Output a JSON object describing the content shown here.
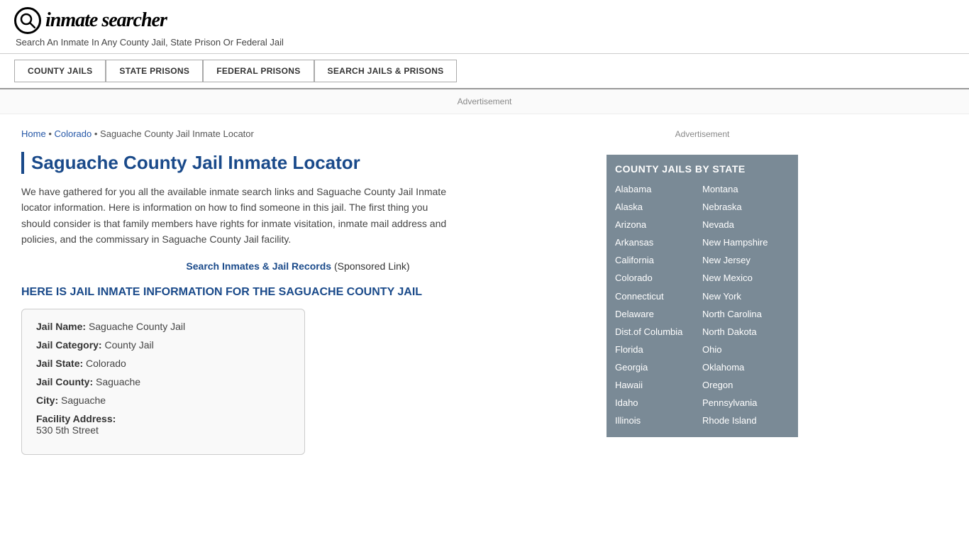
{
  "header": {
    "logo_icon": "🔍",
    "logo_text": "inmate searcher",
    "tagline": "Search An Inmate In Any County Jail, State Prison Or Federal Jail"
  },
  "nav": {
    "buttons": [
      {
        "label": "COUNTY JAILS",
        "id": "county-jails"
      },
      {
        "label": "STATE PRISONS",
        "id": "state-prisons"
      },
      {
        "label": "FEDERAL PRISONS",
        "id": "federal-prisons"
      },
      {
        "label": "SEARCH JAILS & PRISONS",
        "id": "search-jails"
      }
    ]
  },
  "ad_banner": "Advertisement",
  "breadcrumb": {
    "home": "Home",
    "state": "Colorado",
    "current": "Saguache County Jail Inmate Locator"
  },
  "page_title": "Saguache County Jail Inmate Locator",
  "description": "We have gathered for you all the available inmate search links and Saguache County Jail Inmate locator information. Here is information on how to find someone in this jail. The first thing you should consider is that family members have rights for inmate visitation, inmate mail address and policies, and the commissary in Saguache County Jail facility.",
  "sponsored": {
    "link_text": "Search Inmates & Jail Records",
    "link_suffix": "(Sponsored Link)"
  },
  "info_heading": "HERE IS JAIL INMATE INFORMATION FOR THE SAGUACHE COUNTY JAIL",
  "jail_info": {
    "name_label": "Jail Name:",
    "name_value": "Saguache County Jail",
    "category_label": "Jail Category:",
    "category_value": "County Jail",
    "state_label": "Jail State:",
    "state_value": "Colorado",
    "county_label": "Jail County:",
    "county_value": "Saguache",
    "city_label": "City:",
    "city_value": "Saguache",
    "address_label": "Facility Address:",
    "address_value": "530 5th Street"
  },
  "sidebar_ad": "Advertisement",
  "state_box": {
    "title": "COUNTY JAILS BY STATE",
    "left_states": [
      "Alabama",
      "Alaska",
      "Arizona",
      "Arkansas",
      "California",
      "Colorado",
      "Connecticut",
      "Delaware",
      "Dist.of Columbia",
      "Florida",
      "Georgia",
      "Hawaii",
      "Idaho",
      "Illinois"
    ],
    "right_states": [
      "Montana",
      "Nebraska",
      "Nevada",
      "New Hampshire",
      "New Jersey",
      "New Mexico",
      "New York",
      "North Carolina",
      "North Dakota",
      "Ohio",
      "Oklahoma",
      "Oregon",
      "Pennsylvania",
      "Rhode Island"
    ]
  }
}
